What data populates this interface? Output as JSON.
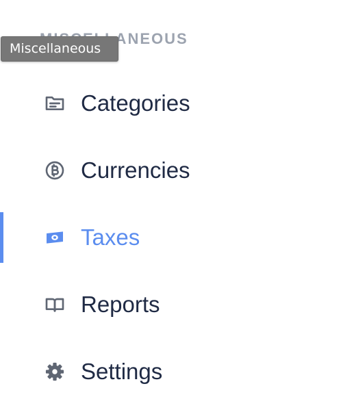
{
  "sidebar": {
    "section_title": "MISCELLANEOUS",
    "tooltip": "Miscellaneous",
    "active_color": "#5b8def",
    "text_color": "#1f2a44",
    "icon_color": "#5f6673",
    "items": [
      {
        "label": "Categories",
        "icon": "folder-icon",
        "active": false
      },
      {
        "label": "Currencies",
        "icon": "bitcoin-icon",
        "active": false
      },
      {
        "label": "Taxes",
        "icon": "cash-icon",
        "active": true
      },
      {
        "label": "Reports",
        "icon": "book-open-icon",
        "active": false
      },
      {
        "label": "Settings",
        "icon": "gear-icon",
        "active": false
      }
    ]
  }
}
